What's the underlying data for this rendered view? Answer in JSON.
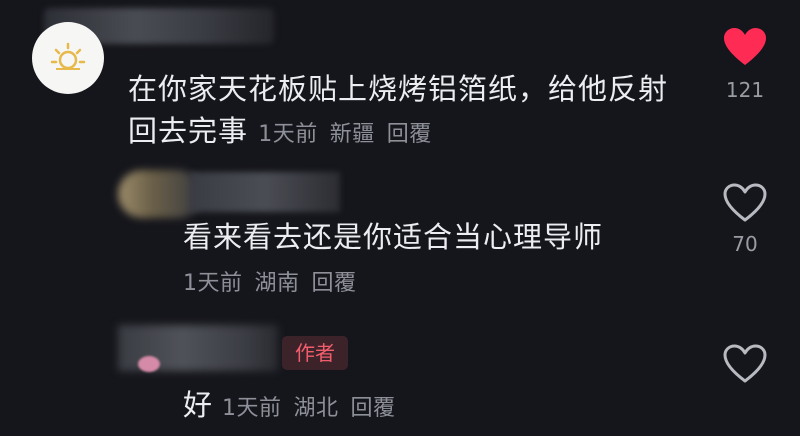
{
  "comments": [
    {
      "text": "在你家天花板贴上烧烤铝箔纸，给他反射回去完事",
      "time": "1天前",
      "location": "新疆",
      "reply_label": "回覆",
      "likes": "121",
      "liked": true,
      "avatar_icon": "sun-icon"
    },
    {
      "text": "看来看去还是你适合当心理导师",
      "time": "1天前",
      "location": "湖南",
      "reply_label": "回覆",
      "likes": "70",
      "liked": false
    },
    {
      "text": "好",
      "time": "1天前",
      "location": "湖北",
      "reply_label": "回覆",
      "badge": "作者",
      "liked": false
    }
  ],
  "colors": {
    "background": "#15161c",
    "like_active": "#fe2c55",
    "like_inactive": "#b8bac1",
    "badge_text": "#f25d6d"
  }
}
